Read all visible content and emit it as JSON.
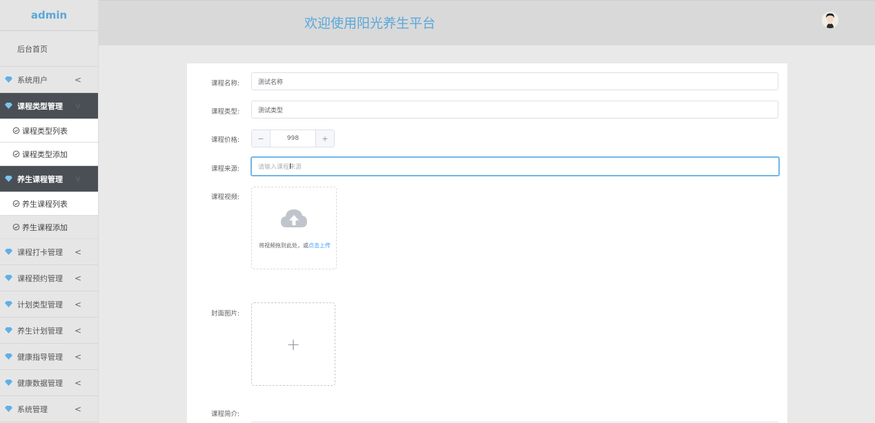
{
  "sidebar": {
    "brand": "admin",
    "home": "后台首页",
    "system_user": "系统用户",
    "course_type_mgmt": "课程类型管理",
    "course_type_list": "课程类型列表",
    "course_type_add": "课程类型添加",
    "health_course_mgmt": "养生课程管理",
    "health_course_list": "养生课程列表",
    "health_course_add": "养生课程添加",
    "checkin_mgmt": "课程打卡管理",
    "booking_mgmt": "课程预约管理",
    "plan_type_mgmt": "计划类型管理",
    "health_plan_mgmt": "养生计划管理",
    "health_guide_mgmt": "健康指导管理",
    "health_data_mgmt": "健康数据管理",
    "system_mgmt": "系统管理",
    "arrow": "<"
  },
  "header": {
    "title": "欢迎使用阳光养生平台"
  },
  "form": {
    "name_label": "课程名称:",
    "name_value": "测试名称",
    "type_label": "课程类型:",
    "type_value": "测试类型",
    "price_label": "课程价格:",
    "price_value": "998",
    "minus": "−",
    "plus": "+",
    "source_label": "课程来源:",
    "source_placeholder": "请输入课程来源",
    "video_label": "课程视频:",
    "video_hint": "将视频拖到此处，或",
    "video_hint_link": "点击上传",
    "cover_label": "封面图片:",
    "cover_plus": "+",
    "intro_label": "课程简介:"
  },
  "colors": {
    "brand": "#5aa7d9",
    "menu_open_bg": "#4a4f55",
    "focus_border": "#6fb6e8",
    "link": "#409eff"
  }
}
